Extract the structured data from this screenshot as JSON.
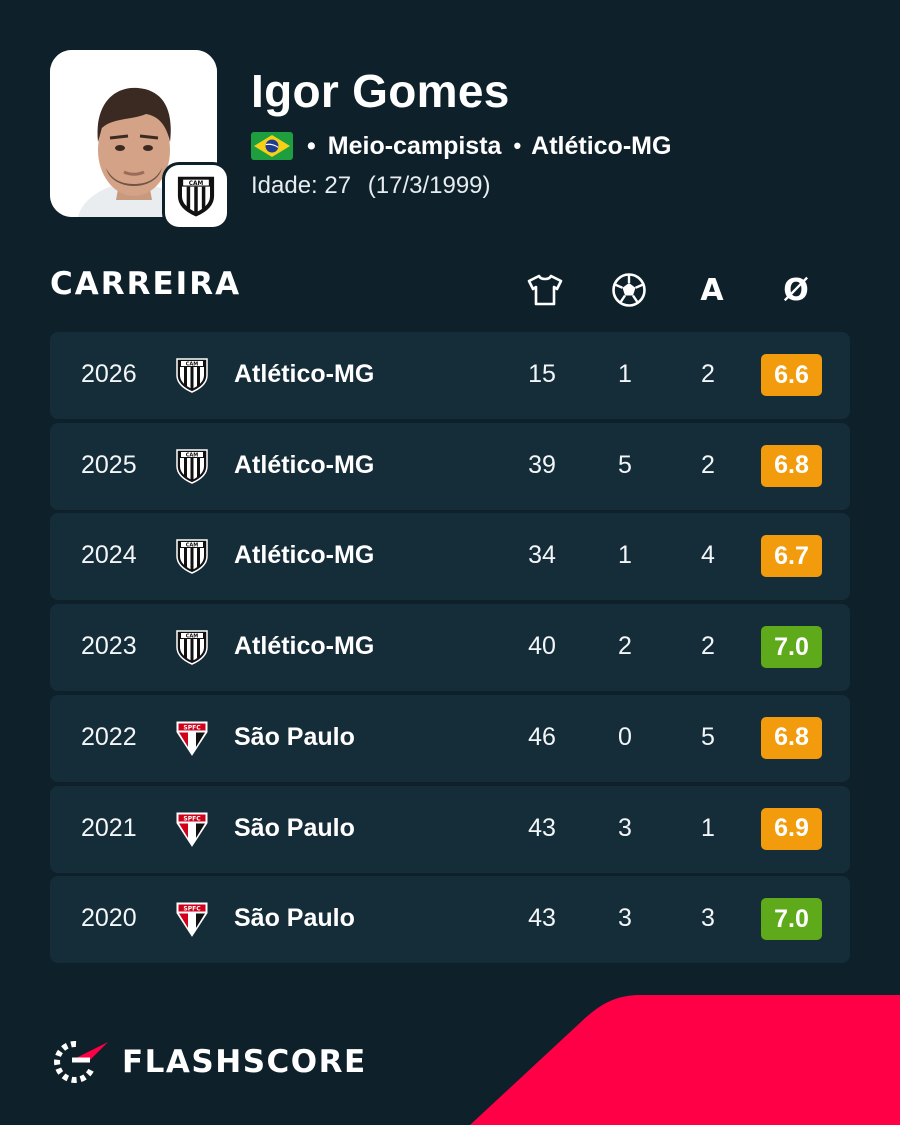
{
  "player": {
    "name": "Igor Gomes",
    "position": "Meio-campista",
    "club": "Atlético-MG",
    "age_label": "Idade: 27",
    "birth_date": "(17/3/1999)",
    "separator": "•"
  },
  "section": {
    "title": "CARREIRA"
  },
  "columns": {
    "appearances_icon": "shirt-icon",
    "goals_icon": "ball-icon",
    "assists_label": "A",
    "rating_label": "Ø"
  },
  "career": [
    {
      "year": "2026",
      "team": "Atlético-MG",
      "crest": "atletico-mg",
      "apps": "15",
      "goals": "1",
      "assists": "2",
      "rating": "6.6",
      "rating_color": "#f29c0d"
    },
    {
      "year": "2025",
      "team": "Atlético-MG",
      "crest": "atletico-mg",
      "apps": "39",
      "goals": "5",
      "assists": "2",
      "rating": "6.8",
      "rating_color": "#f29c0d"
    },
    {
      "year": "2024",
      "team": "Atlético-MG",
      "crest": "atletico-mg",
      "apps": "34",
      "goals": "1",
      "assists": "4",
      "rating": "6.7",
      "rating_color": "#f29c0d"
    },
    {
      "year": "2023",
      "team": "Atlético-MG",
      "crest": "atletico-mg",
      "apps": "40",
      "goals": "2",
      "assists": "2",
      "rating": "7.0",
      "rating_color": "#5faa1b"
    },
    {
      "year": "2022",
      "team": "São Paulo",
      "crest": "sao-paulo",
      "apps": "46",
      "goals": "0",
      "assists": "5",
      "rating": "6.8",
      "rating_color": "#f29c0d"
    },
    {
      "year": "2021",
      "team": "São Paulo",
      "crest": "sao-paulo",
      "apps": "43",
      "goals": "3",
      "assists": "1",
      "rating": "6.9",
      "rating_color": "#f29c0d"
    },
    {
      "year": "2020",
      "team": "São Paulo",
      "crest": "sao-paulo",
      "apps": "43",
      "goals": "3",
      "assists": "3",
      "rating": "7.0",
      "rating_color": "#5faa1b"
    }
  ],
  "brand": {
    "name": "FLASHSCORE",
    "accent_color": "#ff0046"
  },
  "colors": {
    "background": "#0e212a",
    "row_background": "#152d38"
  }
}
